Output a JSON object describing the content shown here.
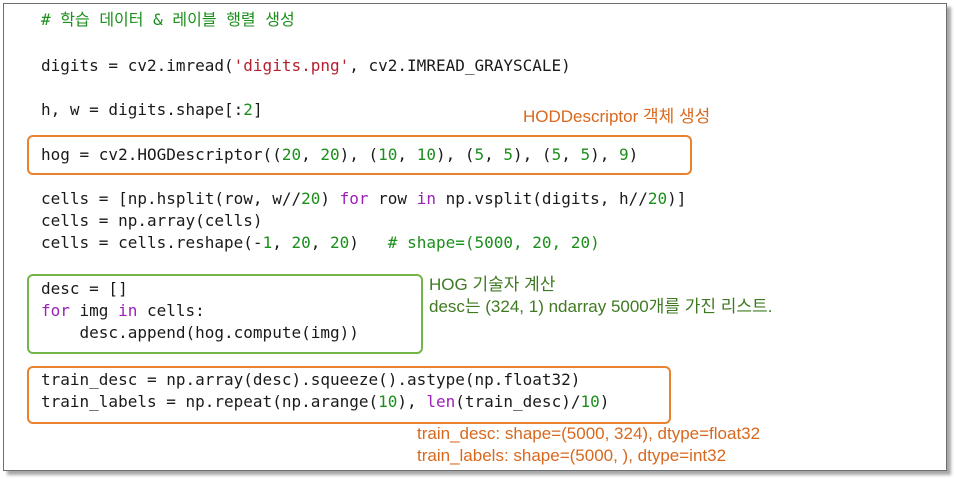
{
  "code": {
    "comment_line": "# 학습 데이터 & 레이블 행렬 생성",
    "l2_a": "digits = cv2.imread(",
    "l2_str": "'digits.png'",
    "l2_b": ", cv2.IMREAD_GRAYSCALE)",
    "l3_a": "h, w = digits.shape[:",
    "l3_n": "2",
    "l3_b": "]",
    "l4_a": "hog = cv2.HOGDescriptor((",
    "l4_n1": "20",
    "l4_c1": ", ",
    "l4_n2": "20",
    "l4_b": "), (",
    "l4_n3": "10",
    "l4_c2": ", ",
    "l4_n4": "10",
    "l4_c3": "), (",
    "l4_n5": "5",
    "l4_c4": ", ",
    "l4_n6": "5",
    "l4_c5": "), (",
    "l4_n7": "5",
    "l4_c6": ", ",
    "l4_n8": "5",
    "l4_c7": "), ",
    "l4_n9": "9",
    "l4_c8": ")",
    "l5_a": "cells = [np.hsplit(row, w//",
    "l5_n1": "20",
    "l5_b": ") ",
    "l5_kw1": "for",
    "l5_c": " row ",
    "l5_kw2": "in",
    "l5_d": " np.vsplit(digits, h//",
    "l5_n2": "20",
    "l5_e": ")]",
    "l6": "cells = np.array(cells)",
    "l7_a": "cells = cells.reshape(-",
    "l7_n1": "1",
    "l7_c1": ", ",
    "l7_n2": "20",
    "l7_c2": ", ",
    "l7_n3": "20",
    "l7_b": ")   ",
    "l7_cm": "# shape=(5000, 20, 20)",
    "l8": "desc = []",
    "l9_kw1": "for",
    "l9_a": " img ",
    "l9_kw2": "in",
    "l9_b": " cells:",
    "l10": "    desc.append(hog.compute(img))",
    "l11": "train_desc = np.array(desc).squeeze().astype(np.float32)",
    "l12_a": "train_labels = np.repeat(np.arange(",
    "l12_n1": "10",
    "l12_b": "), ",
    "l12_kw": "len",
    "l12_c": "(train_desc)/",
    "l12_n2": "10",
    "l12_d": ")"
  },
  "notes": {
    "hog_descriptor": "HODDescriptor 객체 생성",
    "hog_compute_title": "HOG 기술자 계산",
    "hog_compute_detail": "desc는 (324, 1) ndarray 5000개를 가진 리스트.",
    "train_desc_shape": "train_desc: shape=(5000, 324), dtype=float32",
    "train_labels_shape": "train_labels: shape=(5000, ), dtype=int32"
  },
  "colors": {
    "orange_box": "#e8822e",
    "green_box": "#74b54a",
    "orange_text": "#d8681e",
    "green_text": "#3f7a22",
    "keyword": "#9a22b8",
    "string": "#b5202e",
    "comment": "#1b8f1b"
  }
}
